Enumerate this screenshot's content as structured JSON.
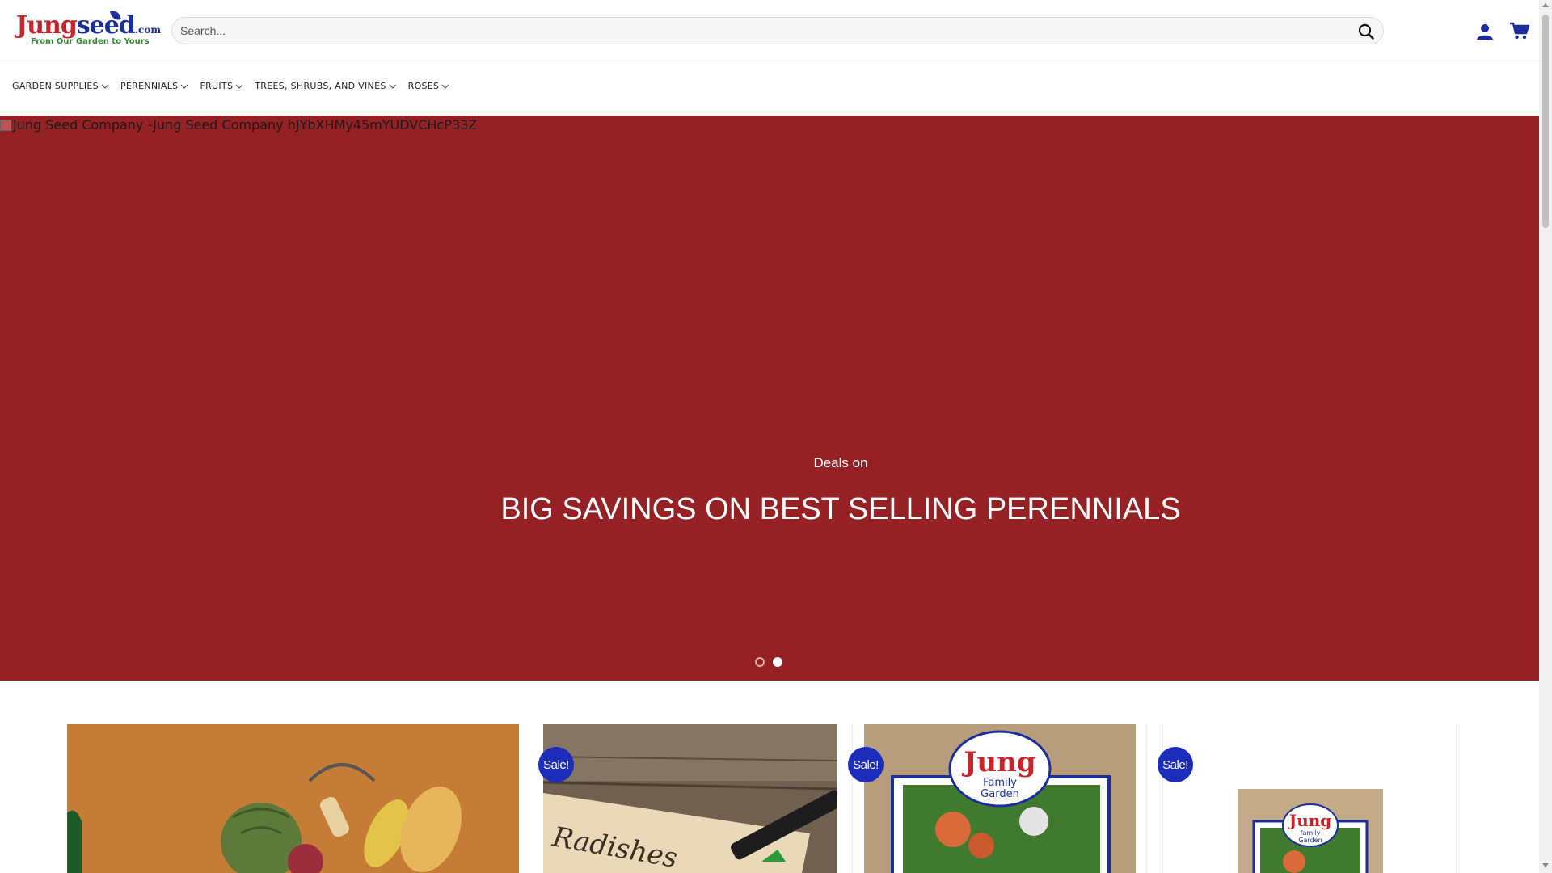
{
  "header": {
    "logo": {
      "brand_j": "Jung",
      "brand_rest": "seed",
      "brand_tld": ".com",
      "tagline": "From Our Garden to Yours"
    },
    "search": {
      "placeholder": "Search..."
    },
    "icons": {
      "search": "search-icon",
      "account": "user-icon",
      "cart": "cart-icon"
    }
  },
  "nav": {
    "items": [
      {
        "label": "GARDEN SUPPLIES"
      },
      {
        "label": "PERENNIALS"
      },
      {
        "label": "FRUITS"
      },
      {
        "label": "TREES, SHRUBS, AND VINES"
      },
      {
        "label": "ROSES"
      }
    ]
  },
  "hero": {
    "image_alt": "Jung Seed Company -Jung Seed Company hJYbXHMy45mYUDVCHcP33Z",
    "subtitle": "Deals on",
    "title": "BIG SAVINGS ON BEST SELLING PERENNIALS",
    "background_color": "#962125",
    "slides": {
      "count": 2,
      "active": 2
    }
  },
  "products": {
    "badge_color": "#1c2dbb",
    "cards": [
      {
        "sale": null
      },
      {
        "sale": "Sale!",
        "plant_label": "Radishes"
      },
      {
        "sale": "Sale!",
        "brand_line1": "Jung",
        "brand_line2": "Family",
        "brand_line3": "Garden"
      },
      {
        "sale": "Sale!",
        "brand_line1": "Jung",
        "brand_line2": "family",
        "brand_line3": "Garden"
      }
    ]
  },
  "colors": {
    "brand_red": "#c8242b",
    "brand_blue": "#1b2f9c",
    "tagline_green": "#2e8b2e"
  }
}
